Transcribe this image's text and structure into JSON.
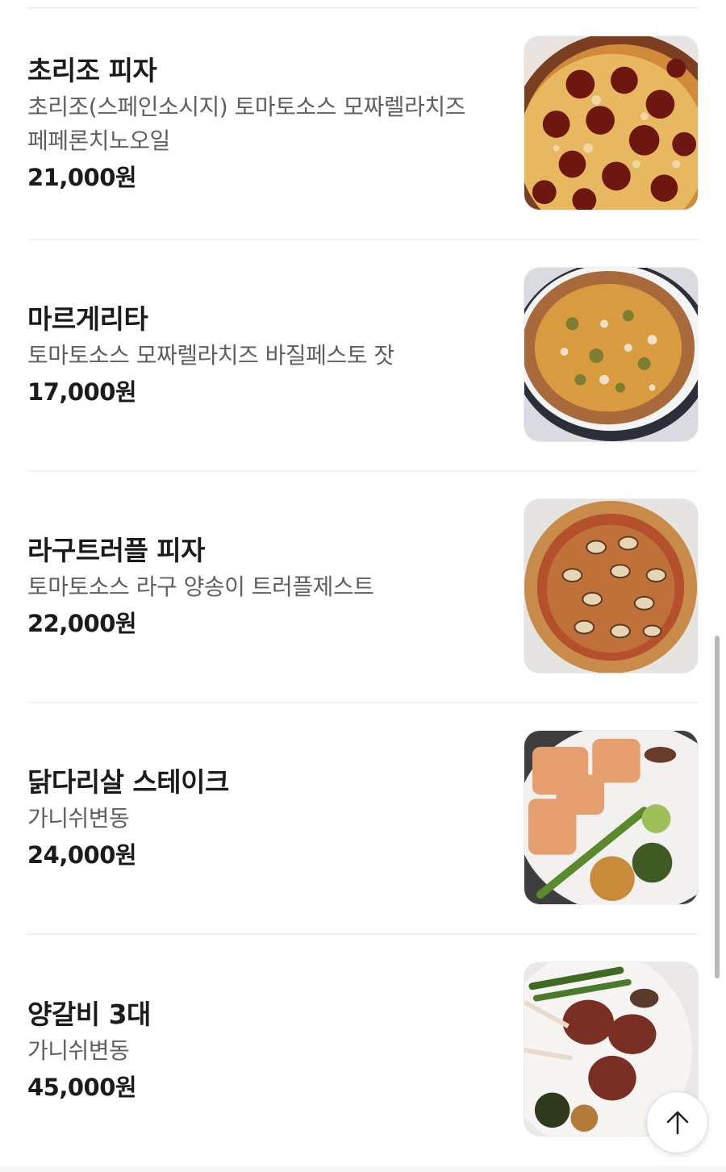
{
  "menu": {
    "items": [
      {
        "name": "초리조 피자",
        "description": "초리조(스페인소시지) 토마토소스 모짜렐라치즈 페페론치노오일",
        "price": "21,000원",
        "image_icon": "chorizo-pizza-photo"
      },
      {
        "name": "마르게리타",
        "description": "토마토소스 모짜렐라치즈 바질페스토 잣",
        "price": "17,000원",
        "image_icon": "margherita-pizza-photo"
      },
      {
        "name": "라구트러플 피자",
        "description": "토마토소스 라구 양송이 트러플제스트",
        "price": "22,000원",
        "image_icon": "ragu-truffle-pizza-photo"
      },
      {
        "name": "닭다리살 스테이크",
        "description": "가니쉬변동",
        "price": "24,000원",
        "image_icon": "chicken-steak-photo"
      },
      {
        "name": "양갈비 3대",
        "description": "가니쉬변동",
        "price": "45,000원",
        "image_icon": "lamb-chops-photo"
      }
    ]
  },
  "controls": {
    "scroll_top_icon": "arrow-up-icon"
  }
}
